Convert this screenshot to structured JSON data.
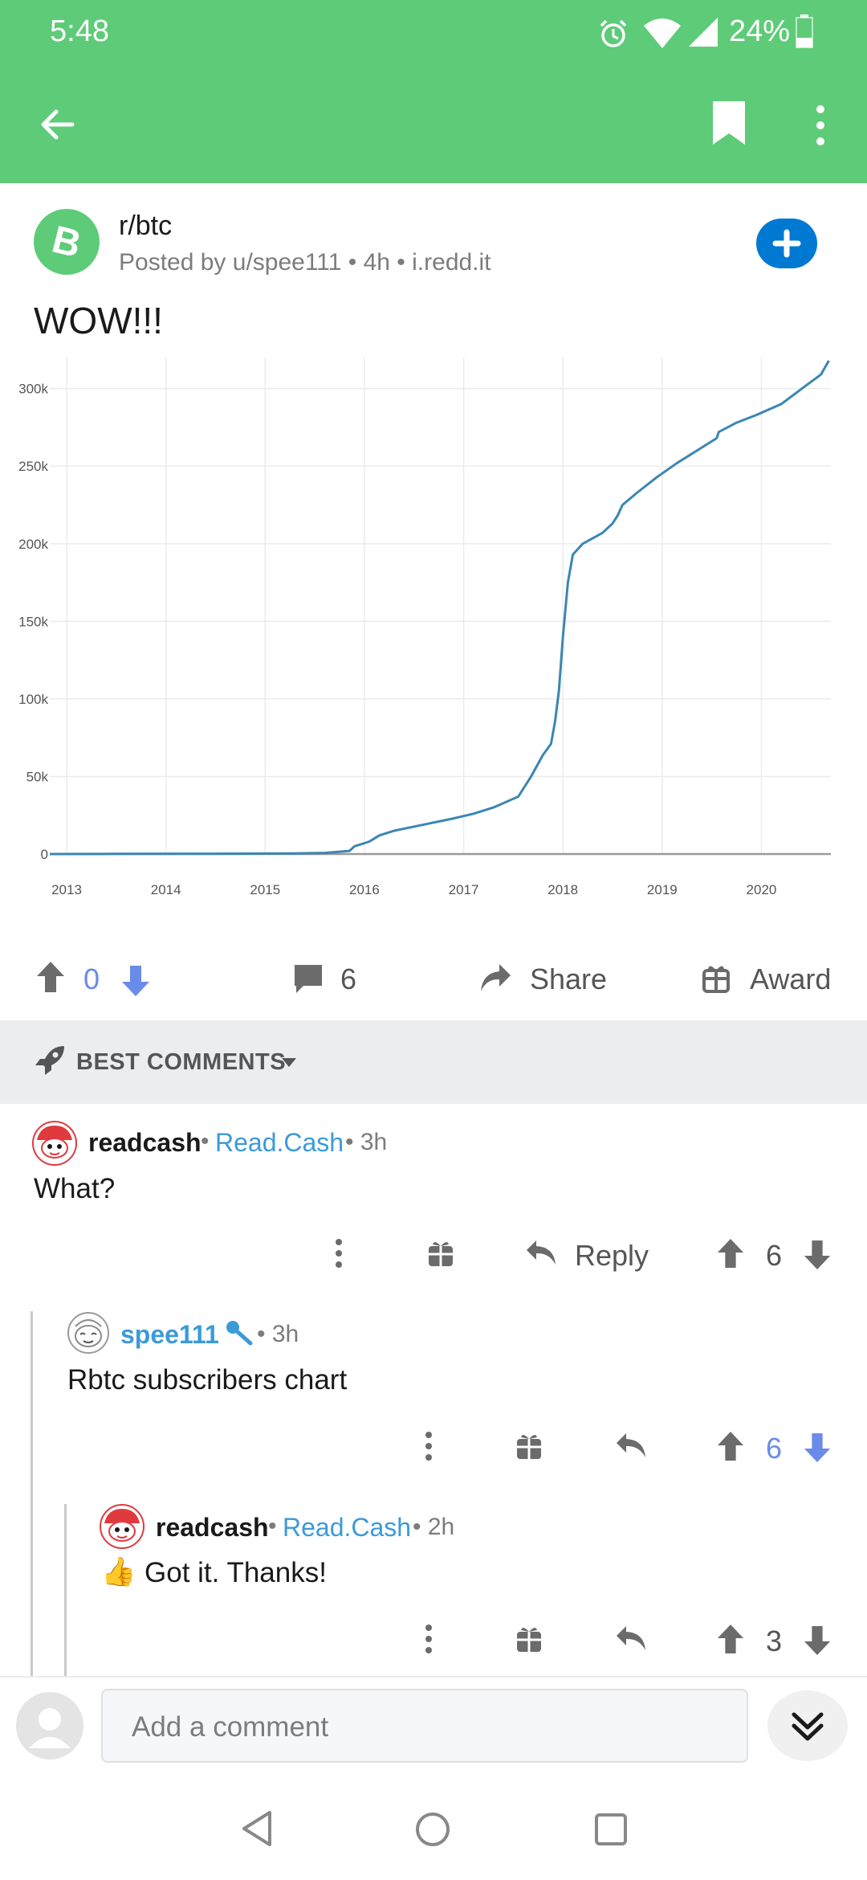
{
  "status_bar": {
    "time": "5:48",
    "battery": "24%"
  },
  "post": {
    "subreddit": "r/btc",
    "meta": "Posted by u/spee111 • 4h • i.redd.it",
    "title": "WOW!!!",
    "score": "0",
    "comments_count": "6",
    "share_label": "Share",
    "award_label": "Award"
  },
  "chart_data": {
    "type": "line",
    "title": "",
    "xlabel": "",
    "ylabel": "",
    "x_ticks": [
      "2013",
      "2014",
      "2015",
      "2016",
      "2017",
      "2018",
      "2019",
      "2020"
    ],
    "y_ticks": [
      "0",
      "50k",
      "100k",
      "150k",
      "200k",
      "250k",
      "300k"
    ],
    "xlim": [
      2012.83,
      2020.7
    ],
    "ylim": [
      0,
      320000
    ],
    "series": [
      {
        "color": "#3a86b4",
        "x": [
          2012.83,
          2013.5,
          2014.5,
          2015.3,
          2015.6,
          2015.85,
          2015.9,
          2016.0,
          2016.05,
          2016.15,
          2016.3,
          2016.6,
          2016.9,
          2017.1,
          2017.3,
          2017.55,
          2017.68,
          2017.8,
          2017.88,
          2017.92,
          2017.96,
          2018.0,
          2018.05,
          2018.1,
          2018.2,
          2018.4,
          2018.5,
          2018.55,
          2018.6,
          2018.75,
          2018.95,
          2019.15,
          2019.35,
          2019.55,
          2019.57,
          2019.75,
          2019.95,
          2020.2,
          2020.45,
          2020.6,
          2020.68
        ],
        "y": [
          0,
          100,
          200,
          400,
          700,
          2000,
          5000,
          7000,
          8000,
          12000,
          15000,
          19000,
          23000,
          26000,
          30000,
          37000,
          50000,
          64000,
          71000,
          85000,
          105000,
          140000,
          175000,
          193000,
          200000,
          207000,
          213000,
          218000,
          225000,
          233000,
          243000,
          252000,
          260000,
          268000,
          272000,
          278000,
          283000,
          290000,
          302000,
          309000,
          318000
        ]
      }
    ]
  },
  "best_comments_label": "BEST COMMENTS",
  "comments": [
    {
      "user": "readcash",
      "link": "Read.Cash",
      "time": "• 3h",
      "body": "What?",
      "reply_label": "Reply",
      "score": "6"
    },
    {
      "user": "spee111",
      "time": "• 3h",
      "body": "Rbtc subscribers chart",
      "score": "6"
    },
    {
      "user": "readcash",
      "link": "Read.Cash",
      "time": "• 2h",
      "body": "Got it. Thanks!",
      "emoji": "👍",
      "score": "3"
    }
  ],
  "bottom": {
    "add_comment_placeholder": "Add a comment"
  },
  "icons": {
    "back": "arrow-left-icon",
    "bookmark": "bookmark-icon",
    "more": "more-vert-icon",
    "join": "plus-icon",
    "upvote": "arrow-up-icon",
    "downvote": "arrow-down-icon",
    "comment": "comment-icon",
    "share": "share-icon",
    "award": "gift-icon",
    "rocket": "rocket-icon"
  },
  "colors": {
    "header_green": "#5ecb78",
    "blue": "#0079d3",
    "link_blue": "#3b9ad9",
    "downvote_blue": "#6a8bea"
  }
}
